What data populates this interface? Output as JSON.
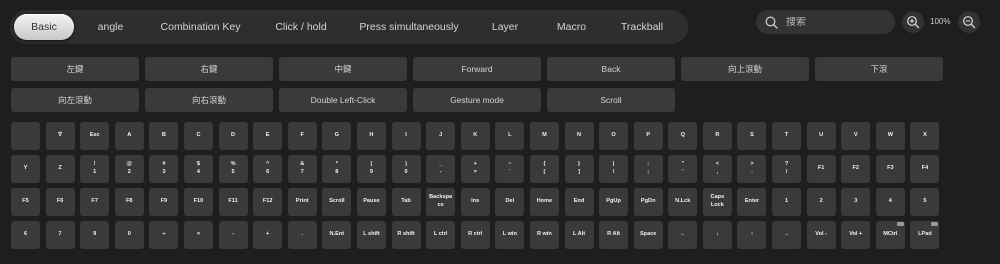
{
  "tabs": [
    {
      "label": "Basic",
      "active": true
    },
    {
      "label": "angle"
    },
    {
      "label": "Combination Key"
    },
    {
      "label": "Click / hold"
    },
    {
      "label": "Press simultaneously"
    },
    {
      "label": "Layer"
    },
    {
      "label": "Macro"
    },
    {
      "label": "Trackball"
    }
  ],
  "search": {
    "placeholder": "搜索",
    "icon": "search-icon"
  },
  "zoom": {
    "level": "100%",
    "in_icon": "zoom-in-icon",
    "out_icon": "zoom-out-icon"
  },
  "function_buttons": [
    "左鍵",
    "右鍵",
    "中鍵",
    "Forward",
    "Back",
    "向上滾動",
    "下滾",
    "向左滾動",
    "向右滾動",
    "Double Left-Click",
    "Gesture mode",
    "Scroll"
  ],
  "key_rows": [
    [
      "",
      "∇",
      "Esc",
      "A",
      "B",
      "C",
      "D",
      "E",
      "F",
      "G",
      "H",
      "I",
      "J",
      "K",
      "L",
      "M",
      "N",
      "O",
      "P",
      "Q",
      "R",
      "S",
      "T",
      "U",
      "V",
      "W",
      "X",
      "Y"
    ],
    [
      "Z",
      "!\n1",
      "@\n2",
      "#\n3",
      "$\n4",
      "%\n5",
      "^\n6",
      "&\n7",
      "*\n8",
      "(\n9",
      ")\n0",
      "_\n-",
      "+\n=",
      "~\n`",
      "{\n[",
      "}\n]",
      "|\n\\",
      ":\n;",
      "\"\n'",
      "<\n,",
      ">\n.",
      "?\n/",
      "F1",
      "F2",
      "F3",
      "F4",
      "F5",
      "F6"
    ],
    [
      "F7",
      "F8",
      "F9",
      "F10",
      "F11",
      "F12",
      "Print",
      "Scroll",
      "Pause",
      "Tab",
      "Backspa\nce",
      "Ins",
      "Del",
      "Home",
      "End",
      "PgUp",
      "PgDn",
      "N.Lck",
      "Caps\nLock",
      "Enter",
      "1",
      "2",
      "3",
      "4",
      "5",
      "6",
      "7"
    ],
    [
      "9",
      "0",
      "÷",
      "×",
      "-",
      "+",
      ".",
      "N.Ent",
      "L shift",
      "R shift",
      "L ctrl",
      "R ctrl",
      "L win",
      "R win",
      "L Alt",
      "R Alt",
      "Space",
      "←",
      "↓",
      "↑",
      "→",
      "Vol -",
      "Vol +",
      "MCtrl",
      "LPad"
    ]
  ],
  "badged_keys": [
    "MCtrl",
    "LPad"
  ],
  "colors": {
    "background": "#1e1e1e",
    "panel": "#2e2e2e",
    "key": "#3a3a3a",
    "active_tab": "#e0e0e0"
  }
}
